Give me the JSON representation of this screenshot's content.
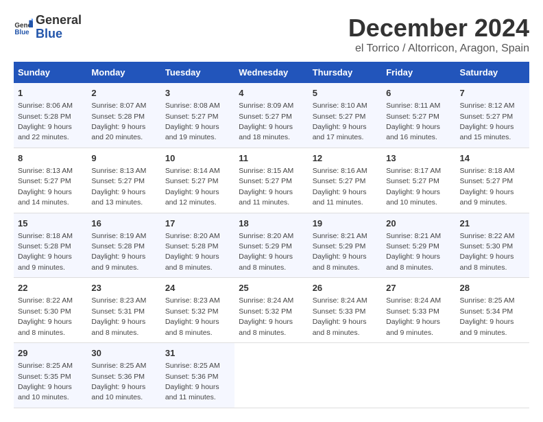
{
  "header": {
    "logo_general": "General",
    "logo_blue": "Blue",
    "main_title": "December 2024",
    "subtitle": "el Torrico / Altorricon, Aragon, Spain"
  },
  "calendar": {
    "days_of_week": [
      "Sunday",
      "Monday",
      "Tuesday",
      "Wednesday",
      "Thursday",
      "Friday",
      "Saturday"
    ],
    "weeks": [
      [
        {
          "day": "1",
          "sunrise": "Sunrise: 8:06 AM",
          "sunset": "Sunset: 5:28 PM",
          "daylight": "Daylight: 9 hours and 22 minutes."
        },
        {
          "day": "2",
          "sunrise": "Sunrise: 8:07 AM",
          "sunset": "Sunset: 5:28 PM",
          "daylight": "Daylight: 9 hours and 20 minutes."
        },
        {
          "day": "3",
          "sunrise": "Sunrise: 8:08 AM",
          "sunset": "Sunset: 5:27 PM",
          "daylight": "Daylight: 9 hours and 19 minutes."
        },
        {
          "day": "4",
          "sunrise": "Sunrise: 8:09 AM",
          "sunset": "Sunset: 5:27 PM",
          "daylight": "Daylight: 9 hours and 18 minutes."
        },
        {
          "day": "5",
          "sunrise": "Sunrise: 8:10 AM",
          "sunset": "Sunset: 5:27 PM",
          "daylight": "Daylight: 9 hours and 17 minutes."
        },
        {
          "day": "6",
          "sunrise": "Sunrise: 8:11 AM",
          "sunset": "Sunset: 5:27 PM",
          "daylight": "Daylight: 9 hours and 16 minutes."
        },
        {
          "day": "7",
          "sunrise": "Sunrise: 8:12 AM",
          "sunset": "Sunset: 5:27 PM",
          "daylight": "Daylight: 9 hours and 15 minutes."
        }
      ],
      [
        {
          "day": "8",
          "sunrise": "Sunrise: 8:13 AM",
          "sunset": "Sunset: 5:27 PM",
          "daylight": "Daylight: 9 hours and 14 minutes."
        },
        {
          "day": "9",
          "sunrise": "Sunrise: 8:13 AM",
          "sunset": "Sunset: 5:27 PM",
          "daylight": "Daylight: 9 hours and 13 minutes."
        },
        {
          "day": "10",
          "sunrise": "Sunrise: 8:14 AM",
          "sunset": "Sunset: 5:27 PM",
          "daylight": "Daylight: 9 hours and 12 minutes."
        },
        {
          "day": "11",
          "sunrise": "Sunrise: 8:15 AM",
          "sunset": "Sunset: 5:27 PM",
          "daylight": "Daylight: 9 hours and 11 minutes."
        },
        {
          "day": "12",
          "sunrise": "Sunrise: 8:16 AM",
          "sunset": "Sunset: 5:27 PM",
          "daylight": "Daylight: 9 hours and 11 minutes."
        },
        {
          "day": "13",
          "sunrise": "Sunrise: 8:17 AM",
          "sunset": "Sunset: 5:27 PM",
          "daylight": "Daylight: 9 hours and 10 minutes."
        },
        {
          "day": "14",
          "sunrise": "Sunrise: 8:18 AM",
          "sunset": "Sunset: 5:27 PM",
          "daylight": "Daylight: 9 hours and 9 minutes."
        }
      ],
      [
        {
          "day": "15",
          "sunrise": "Sunrise: 8:18 AM",
          "sunset": "Sunset: 5:28 PM",
          "daylight": "Daylight: 9 hours and 9 minutes."
        },
        {
          "day": "16",
          "sunrise": "Sunrise: 8:19 AM",
          "sunset": "Sunset: 5:28 PM",
          "daylight": "Daylight: 9 hours and 9 minutes."
        },
        {
          "day": "17",
          "sunrise": "Sunrise: 8:20 AM",
          "sunset": "Sunset: 5:28 PM",
          "daylight": "Daylight: 9 hours and 8 minutes."
        },
        {
          "day": "18",
          "sunrise": "Sunrise: 8:20 AM",
          "sunset": "Sunset: 5:29 PM",
          "daylight": "Daylight: 9 hours and 8 minutes."
        },
        {
          "day": "19",
          "sunrise": "Sunrise: 8:21 AM",
          "sunset": "Sunset: 5:29 PM",
          "daylight": "Daylight: 9 hours and 8 minutes."
        },
        {
          "day": "20",
          "sunrise": "Sunrise: 8:21 AM",
          "sunset": "Sunset: 5:29 PM",
          "daylight": "Daylight: 9 hours and 8 minutes."
        },
        {
          "day": "21",
          "sunrise": "Sunrise: 8:22 AM",
          "sunset": "Sunset: 5:30 PM",
          "daylight": "Daylight: 9 hours and 8 minutes."
        }
      ],
      [
        {
          "day": "22",
          "sunrise": "Sunrise: 8:22 AM",
          "sunset": "Sunset: 5:30 PM",
          "daylight": "Daylight: 9 hours and 8 minutes."
        },
        {
          "day": "23",
          "sunrise": "Sunrise: 8:23 AM",
          "sunset": "Sunset: 5:31 PM",
          "daylight": "Daylight: 9 hours and 8 minutes."
        },
        {
          "day": "24",
          "sunrise": "Sunrise: 8:23 AM",
          "sunset": "Sunset: 5:32 PM",
          "daylight": "Daylight: 9 hours and 8 minutes."
        },
        {
          "day": "25",
          "sunrise": "Sunrise: 8:24 AM",
          "sunset": "Sunset: 5:32 PM",
          "daylight": "Daylight: 9 hours and 8 minutes."
        },
        {
          "day": "26",
          "sunrise": "Sunrise: 8:24 AM",
          "sunset": "Sunset: 5:33 PM",
          "daylight": "Daylight: 9 hours and 8 minutes."
        },
        {
          "day": "27",
          "sunrise": "Sunrise: 8:24 AM",
          "sunset": "Sunset: 5:33 PM",
          "daylight": "Daylight: 9 hours and 9 minutes."
        },
        {
          "day": "28",
          "sunrise": "Sunrise: 8:25 AM",
          "sunset": "Sunset: 5:34 PM",
          "daylight": "Daylight: 9 hours and 9 minutes."
        }
      ],
      [
        {
          "day": "29",
          "sunrise": "Sunrise: 8:25 AM",
          "sunset": "Sunset: 5:35 PM",
          "daylight": "Daylight: 9 hours and 10 minutes."
        },
        {
          "day": "30",
          "sunrise": "Sunrise: 8:25 AM",
          "sunset": "Sunset: 5:36 PM",
          "daylight": "Daylight: 9 hours and 10 minutes."
        },
        {
          "day": "31",
          "sunrise": "Sunrise: 8:25 AM",
          "sunset": "Sunset: 5:36 PM",
          "daylight": "Daylight: 9 hours and 11 minutes."
        },
        null,
        null,
        null,
        null
      ]
    ]
  }
}
